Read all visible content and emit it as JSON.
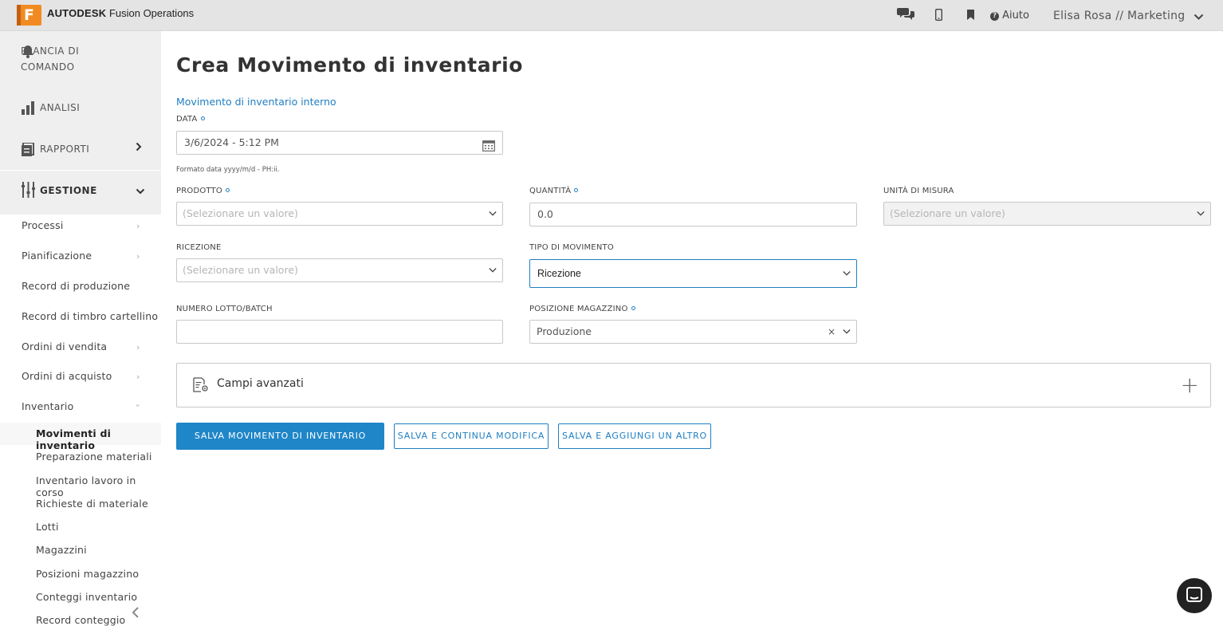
{
  "app": {
    "logo_letter": "F",
    "brand_bold": "AUTODESK",
    "brand_name": "Fusion Operations",
    "help_label": "Aiuto",
    "user": "Elisa Rosa // Marketing"
  },
  "sidebar": {
    "dashboard": "PLANCIA DI COMANDO",
    "analysis": "ANALISI",
    "reports": "RAPPORTI",
    "management": "GESTIONE",
    "items": [
      "Processi",
      "Pianificazione",
      "Record di produzione",
      "Record di timbro cartellino",
      "Ordini di vendita",
      "Ordini di acquisto",
      "Inventario"
    ],
    "sub_items": [
      "Movimenti di inventario",
      "Preparazione materiali",
      "Inventario lavoro in corso",
      "Richieste di materiale",
      "Lotti",
      "Magazzini",
      "Posizioni magazzino",
      "Conteggi inventario",
      "Record conteggio"
    ]
  },
  "page": {
    "title": "Crea Movimento di inventario",
    "subtitle": "Movimento di inventario interno",
    "date_label": "DATA",
    "date_value": "3/6/2024 - 5:12 PM",
    "date_hint": "Formato data yyyy/m/d - PH:ii.",
    "product_label": "PRODOTTO",
    "product_placeholder": "(Selezionare un valore)",
    "quantity_label": "QUANTITÀ",
    "quantity_value": "0.0",
    "unit_label": "UNITÀ DI MISURA",
    "unit_placeholder": "(Selezionare un valore)",
    "receipt_label": "RICEZIONE",
    "receipt_placeholder": "(Selezionare un valore)",
    "move_type_label": "TIPO DI MOVIMENTO",
    "move_type_value": "Ricezione",
    "lot_label": "NUMERO LOTTO/BATCH",
    "lot_value": "",
    "location_label": "POSIZIONE MAGAZZINO",
    "location_value": "Produzione",
    "clear_symbol": "×",
    "advanced_label": "Campi avanzati",
    "advanced_toggle": "+",
    "btn_save": "SALVA MOVIMENTO DI INVENTARIO",
    "btn_save_continue": "SALVA E CONTINUA MODIFICA",
    "btn_save_add": "SALVA E AGGIUNGI UN ALTRO"
  },
  "colors": {
    "accent": "#1f86c8",
    "brand_orange": "#f18b21",
    "topbar": "#e4e4e4"
  },
  "icons": [
    "chat-icon",
    "mobile-icon",
    "bookmark-icon",
    "help-icon",
    "bell-icon",
    "bar-chart-icon",
    "reports-icon",
    "management-icon",
    "calendar-icon",
    "chevron-down-icon",
    "settings-doc-icon",
    "plus-icon",
    "chat-bubble-icon"
  ]
}
